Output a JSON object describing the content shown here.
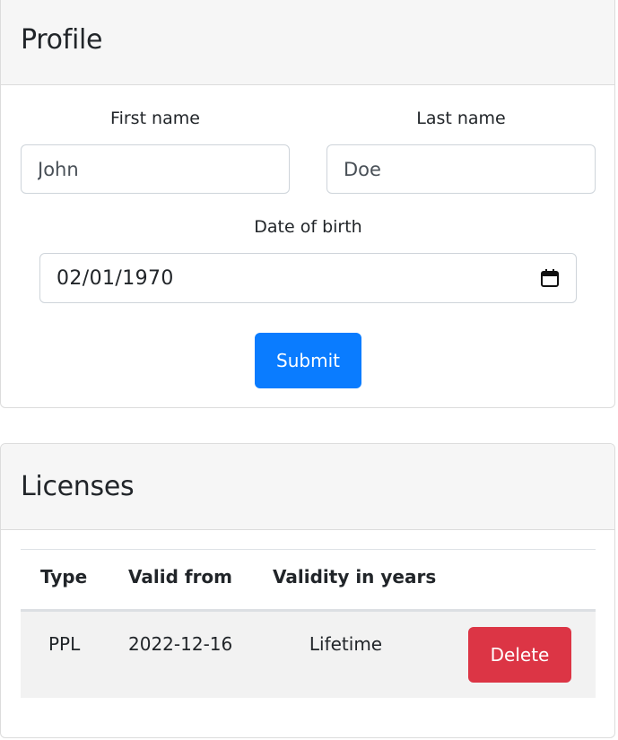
{
  "profile": {
    "title": "Profile",
    "first_name_label": "First name",
    "first_name_value": "John",
    "last_name_label": "Last name",
    "last_name_value": "Doe",
    "dob_label": "Date of birth",
    "dob_value": "02/01/1970",
    "submit_label": "Submit"
  },
  "licenses": {
    "title": "Licenses",
    "columns": [
      "Type",
      "Valid from",
      "Validity in years",
      ""
    ],
    "rows": [
      {
        "type": "PPL",
        "valid_from": "2022-12-16",
        "validity": "Lifetime",
        "action_label": "Delete"
      }
    ]
  },
  "colors": {
    "primary": "#0a7cff",
    "danger": "#dc3545",
    "header_bg": "#f6f6f6",
    "row_bg": "#f2f2f2"
  },
  "icons": {
    "date_picker": "calendar-icon"
  }
}
